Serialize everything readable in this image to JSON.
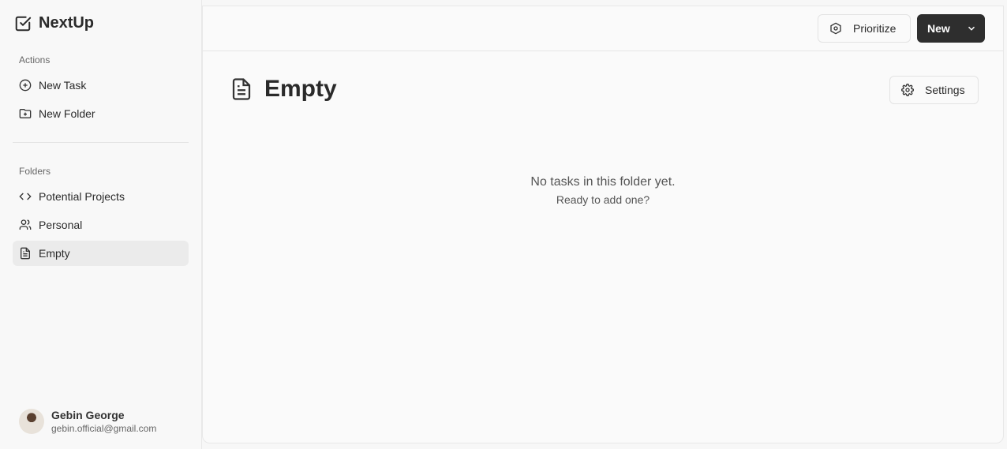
{
  "app": {
    "name": "NextUp"
  },
  "sidebar": {
    "actions_label": "Actions",
    "actions": [
      {
        "label": "New Task",
        "icon": "plus-circle-icon"
      },
      {
        "label": "New Folder",
        "icon": "folder-plus-icon"
      }
    ],
    "folders_label": "Folders",
    "folders": [
      {
        "label": "Potential Projects",
        "icon": "code-icon"
      },
      {
        "label": "Personal",
        "icon": "users-icon"
      },
      {
        "label": "Empty",
        "icon": "file-text-icon",
        "active": true
      }
    ],
    "user": {
      "name": "Gebin George",
      "email": "gebin.official@gmail.com"
    }
  },
  "header": {
    "prioritize_label": "Prioritize",
    "new_label": "New"
  },
  "main": {
    "title": "Empty",
    "settings_label": "Settings",
    "empty_message": "No tasks in this folder yet.",
    "empty_sub": "Ready to add one?"
  }
}
